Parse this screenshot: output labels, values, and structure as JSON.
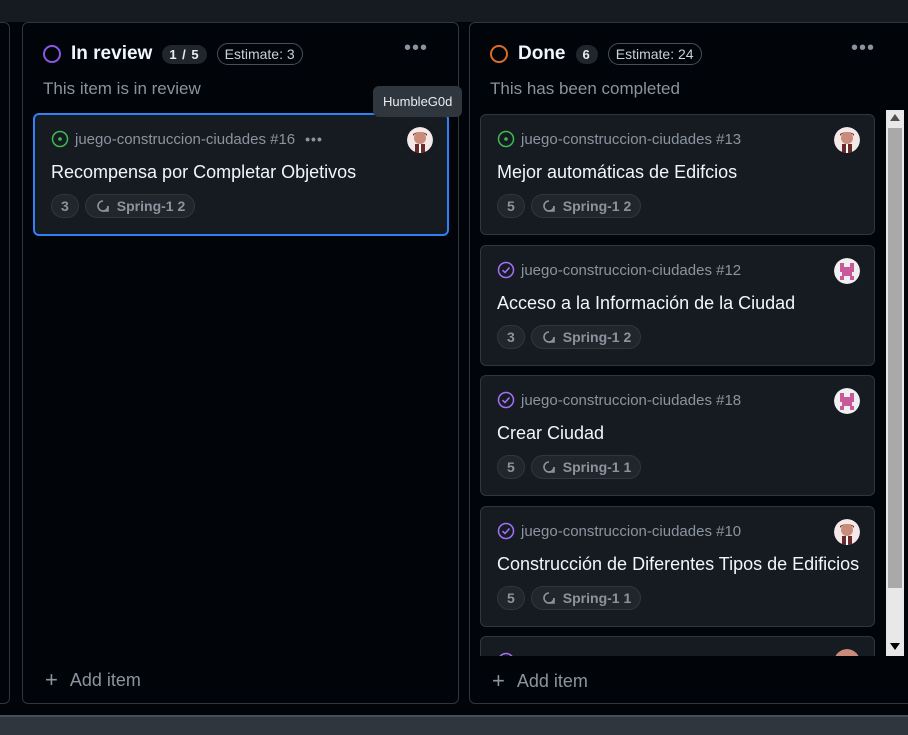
{
  "columns": {
    "review": {
      "title": "In review",
      "count": "1 / 5",
      "estimate": "Estimate: 3",
      "description": "This item is in review",
      "status_color": "#8957e5",
      "add_label": "Add item"
    },
    "done": {
      "title": "Done",
      "count": "6",
      "estimate": "Estimate: 24",
      "description": "This has been completed",
      "status_color": "#db6d28",
      "add_label": "Add item"
    }
  },
  "tooltip": "HumbleG0d",
  "review_cards": [
    {
      "repo": "juego-construccion-ciudades #16",
      "title": "Recompensa por Completar Objetivos",
      "points": "3",
      "iteration": "Spring-1 2",
      "state": "open",
      "avatar": "avatar-humbleg0d"
    }
  ],
  "done_cards": [
    {
      "repo": "juego-construccion-ciudades #13",
      "title": "Mejor automáticas de Edifcios",
      "points": "5",
      "iteration": "Spring-1 2",
      "state": "open",
      "avatar": "avatar-humbleg0d"
    },
    {
      "repo": "juego-construccion-ciudades #12",
      "title": "Acceso a la Información de la Ciudad",
      "points": "3",
      "iteration": "Spring-1 2",
      "state": "closed",
      "avatar": "avatar-pink-identicon"
    },
    {
      "repo": "juego-construccion-ciudades #18",
      "title": "Crear Ciudad",
      "points": "5",
      "iteration": "Spring-1 1",
      "state": "closed",
      "avatar": "avatar-pink-identicon"
    },
    {
      "repo": "juego-construccion-ciudades #10",
      "title": "Construcción de Diferentes Tipos de Edificios",
      "points": "5",
      "iteration": "Spring-1 1",
      "state": "closed",
      "avatar": "avatar-humbleg0d"
    }
  ],
  "colors": {
    "open_issue": "#3fb950",
    "closed_issue": "#a371f7",
    "selected_border": "#2f81f7"
  }
}
